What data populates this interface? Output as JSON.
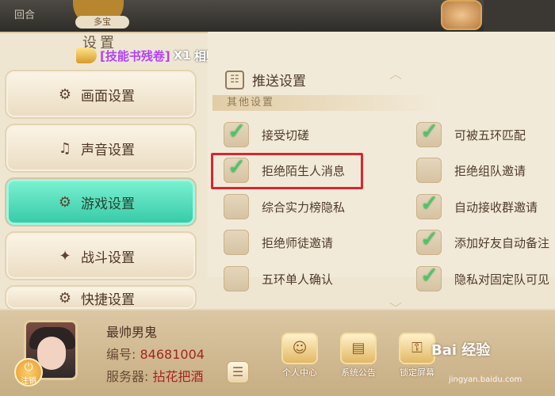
{
  "topbar": {
    "back_label": "回合",
    "pill_label": "多宝"
  },
  "panel": {
    "title": "设置",
    "announcement": {
      "item": "[技能书残卷]",
      "qty": "X1",
      "suffix": "相赠",
      "emoji": "☻"
    }
  },
  "tabs": [
    {
      "label": "画面设置",
      "icon": "brush-settings-icon",
      "active": false
    },
    {
      "label": "声音设置",
      "icon": "music-note-icon",
      "active": false
    },
    {
      "label": "游戏设置",
      "icon": "gear-game-icon",
      "active": true
    },
    {
      "label": "战斗设置",
      "icon": "sword-gear-icon",
      "active": false
    },
    {
      "label": "快捷设置",
      "icon": "shortcut-icon",
      "active": false
    }
  ],
  "content": {
    "section_title": "推送设置",
    "subsection": "其他设置",
    "options_left": [
      {
        "label": "接受切磋",
        "checked": true
      },
      {
        "label": "拒绝陌生人消息",
        "checked": true
      },
      {
        "label": "综合实力榜隐私",
        "checked": false
      },
      {
        "label": "拒绝师徒邀请",
        "checked": false
      },
      {
        "label": "五环单人确认",
        "checked": false
      }
    ],
    "options_right": [
      {
        "label": "可被五环匹配",
        "checked": true
      },
      {
        "label": "拒绝组队邀请",
        "checked": false
      },
      {
        "label": "自动接收群邀请",
        "checked": true
      },
      {
        "label": "添加好友自动备注",
        "checked": true
      },
      {
        "label": "隐私对固定队可见",
        "checked": true
      }
    ]
  },
  "profile": {
    "name": "最帅男鬼",
    "id_key": "编号:",
    "id_value": "84681004",
    "server_key": "服务器:",
    "server_value": "拈花把酒",
    "logout_label": "注销"
  },
  "actions": [
    {
      "label": "个人中心",
      "icon": "person-icon"
    },
    {
      "label": "系统公告",
      "icon": "notice-icon"
    },
    {
      "label": "锁定屏幕",
      "icon": "lock-key-icon"
    }
  ],
  "watermark": {
    "brand": "Bai 经验",
    "url": "jingyan.baidu.com"
  },
  "colors": {
    "active_tab": "#34c9a6",
    "highlight_box": "#d9262f",
    "check": "#3fcf63"
  }
}
